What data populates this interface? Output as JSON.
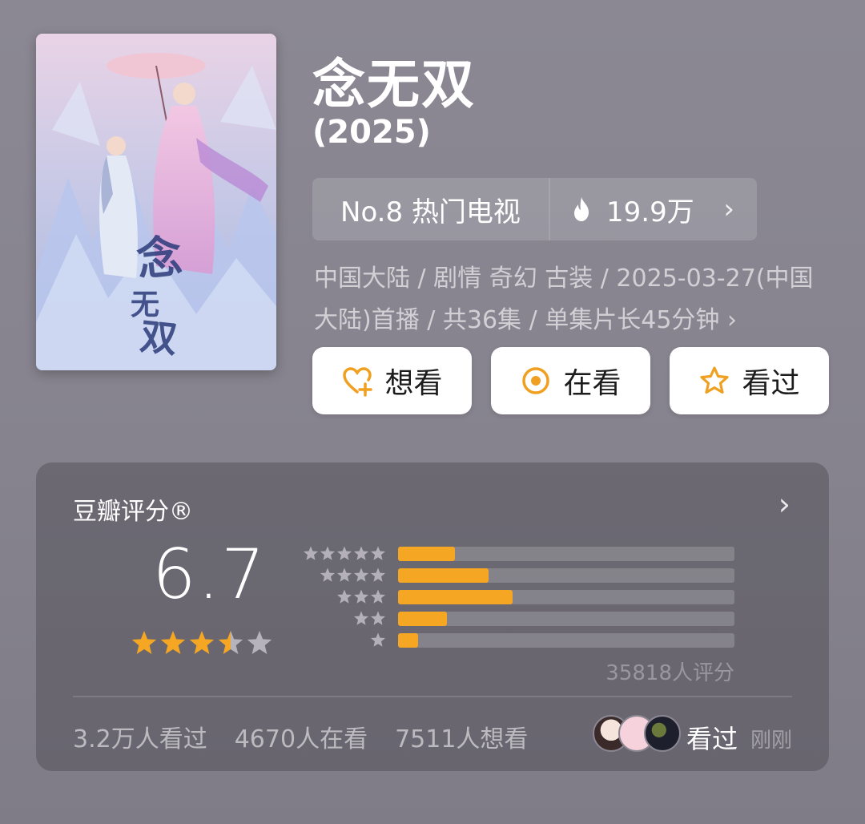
{
  "show": {
    "title": "念无双",
    "year": "(2025)",
    "poster": {
      "calligraphy": "念无双"
    }
  },
  "ranking": {
    "label": "No.8 热门电视",
    "hot_icon": "flame-icon",
    "hot_count": "19.9万",
    "chevron": "›"
  },
  "meta_text": "中国大陆 / 剧情 奇幻 古装 / 2025-03-27(中国大陆)首播 / 共36集 / 单集片长45分钟 ›",
  "actions": [
    {
      "label": "想看",
      "icon": "heart-plus-icon"
    },
    {
      "label": "在看",
      "icon": "target-circle-icon"
    },
    {
      "label": "看过",
      "icon": "star-outline-icon"
    }
  ],
  "rating": {
    "label": "豆瓣评分®",
    "chevron": "›",
    "score": "6.7",
    "stars_filled": 3.5,
    "stars_total": 5,
    "distribution": [
      {
        "stars": 5,
        "fraction": 0.17
      },
      {
        "stars": 4,
        "fraction": 0.27
      },
      {
        "stars": 3,
        "fraction": 0.34
      },
      {
        "stars": 2,
        "fraction": 0.145
      },
      {
        "stars": 1,
        "fraction": 0.06
      }
    ],
    "votes": "35818人评分",
    "accent_color": "#f5a623"
  },
  "stats": {
    "watched": "3.2万人看过",
    "watching": "4670人在看",
    "want": "7511人想看"
  },
  "friends": {
    "status": "看过",
    "time": "刚刚"
  }
}
